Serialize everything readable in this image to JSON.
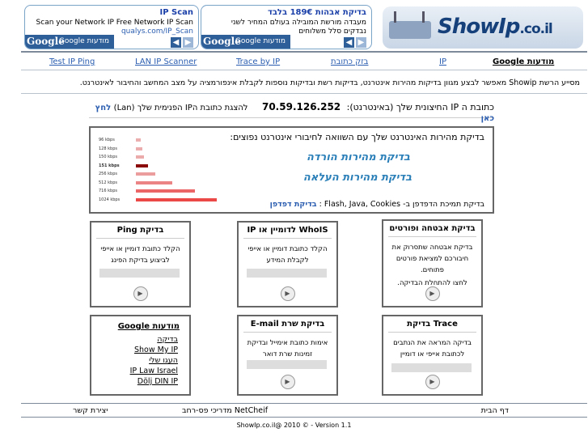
{
  "ads": [
    {
      "title": "בדיקת אבהות 189€ בלבד",
      "desc": "מעבדה מורשת המובילה בעולם המחיר לשני נבדקים סלל משלוחים",
      "url": "",
      "google_label": "מודעות Google"
    },
    {
      "title": "IP Scan",
      "desc": "Scan your Network IP Free Network IP Scan",
      "url": "qualys.com/IP_Scan",
      "google_label": "מודעות Google"
    }
  ],
  "logo": {
    "text": "ShowIp",
    "suffix": ".co.il"
  },
  "nav": [
    {
      "label": "מודעות Google",
      "bold": true
    },
    {
      "label": "IP"
    },
    {
      "label": "בזק כתובת"
    },
    {
      "label": "Trace by IP"
    },
    {
      "label": "LAN IP Scanner"
    },
    {
      "label": "Test IP Ping"
    }
  ],
  "description": "מסייע הרשת Showip מאפשר לבצע מגוון בדיקות מהירות אינטרנט, בדיקות רשת ובדיקות נוספות לקבלת אינפורמציה על מצב המחשב והחיבור לאינטרנט.",
  "ip": {
    "label": "כתובת ה IP החיצונית שלך (באינטרנט):",
    "value": "70.59.126.252",
    "internal_label": "להצגת כתובת הIP הפנימית שלך (Lan)",
    "internal_link": "לחץ כאן"
  },
  "speed": {
    "title": "בדיקת מהירות האינטרנט שלך עם השוואה לחיבורי אינטרנט נפוצים:",
    "download": "בדיקת מהירות הורדה",
    "upload": "בדיקת מהירות העלאה",
    "support": "בדיקת תמיכת הדפדפן ב- Flash, Java, Cookies :",
    "support_link": "בדיקת דפדפן",
    "bars": [
      {
        "label": "96 kbps",
        "frac": 0.06
      },
      {
        "label": "128 kbps",
        "frac": 0.08
      },
      {
        "label": "150 kbps",
        "frac": 0.1
      },
      {
        "label": "151 kbps",
        "frac": 0.15,
        "dark": true
      },
      {
        "label": "256 kbps",
        "frac": 0.24
      },
      {
        "label": "512 kbps",
        "frac": 0.45
      },
      {
        "label": "716 kbps",
        "frac": 0.73
      },
      {
        "label": "1024 kbps",
        "frac": 1.0
      }
    ]
  },
  "cards": {
    "ports": {
      "title": "בדיקת אבטחה ופורטים",
      "text": "בדיקת אבטחה שתסרוק את חיבורכם למציאת פורטים פתוחים.",
      "cta": "לחצו להתחלת הבדיקה."
    },
    "whois": {
      "title": "WhoIS לדומיין או IP",
      "text": "הקלד כתובת דומיין או אייפי לקבלת המידע"
    },
    "ping": {
      "title": "בדיקת Ping",
      "text": "הקלד כתובת דומיין או אייפי לביצוע בדיקת הפינג"
    },
    "trace": {
      "title": "Trace בדיקת",
      "text": "בדיקה המראה את הנתבים לכתובת אייפי או דומיין"
    },
    "email": {
      "title": "בדיקת שרת E-mail",
      "text": "אימות כתובת אימייל ובדיקת זמינות שרת דואר"
    },
    "google": {
      "title": "מודעות Google",
      "links": [
        "בדיקה",
        "Show My IP",
        "העגו שלי",
        "IP Law Israel",
        "Dölj DIN IP"
      ]
    }
  },
  "footer": {
    "home": "דף הבית",
    "guides": "NetCheif מדריכי פס-רחב",
    "contact": "יצירת קשר",
    "copyright": "ShowIp.co.il@ 2010 © - Version 1.1"
  }
}
